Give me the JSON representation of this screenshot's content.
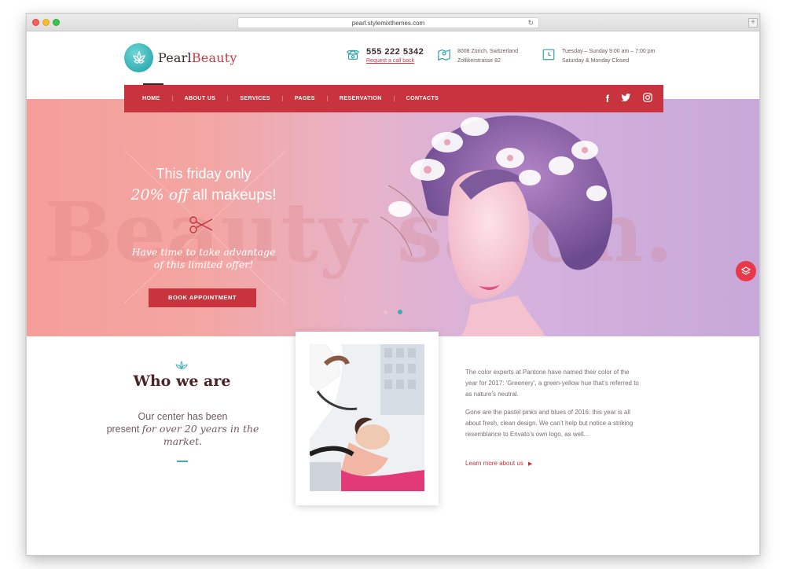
{
  "browser": {
    "url": "pearl.stylemixthemes.com"
  },
  "logo": {
    "name_part1": "Pearl",
    "name_part2": "Beauty"
  },
  "contact": {
    "phone": "555 222 5342",
    "callback": "Request a call back",
    "address_line1": "8008 Zürich, Switzerland",
    "address_line2": "Zollikerstrasse 82",
    "hours_line1": "Tuesday – Sunday 9:00 am – 7:00 pm",
    "hours_line2": "Saturday & Monday Closed"
  },
  "nav": {
    "items": [
      "HOME",
      "ABOUT US",
      "SERVICES",
      "PAGES",
      "RESERVATION",
      "CONTACTS"
    ],
    "social": [
      "facebook-icon",
      "twitter-icon",
      "instagram-icon"
    ]
  },
  "hero": {
    "watermark": "Beauty salon.",
    "line1": "This friday only",
    "line2_em": "20% off",
    "line2_rest": " all makeups!",
    "sub1": "Have time to take advantage",
    "sub2": "of this limited offer!",
    "button": "BOOK APPOINTMENT",
    "slides": 2,
    "active_slide": 2
  },
  "who": {
    "title": "Who we are",
    "text1": "Our center has been",
    "text2": "present",
    "text3": "for over 20 years in the",
    "text4": "market."
  },
  "about": {
    "para1": "The color experts at Pantone have named their color of the year for 2017: ‘Greenery’, a green-yellow hue that’s referred to as nature’s neutral.",
    "para2": "Gone are the pastel pinks and blues of 2016: this year is all about fresh, clean design. We can’t help but notice a striking resemblance to Envato’s own logo, as well...",
    "link": "Learn more about us"
  },
  "colors": {
    "brand_red": "#c8333d",
    "accent_teal": "#3fa9b4",
    "heading_dark": "#4b2329"
  }
}
